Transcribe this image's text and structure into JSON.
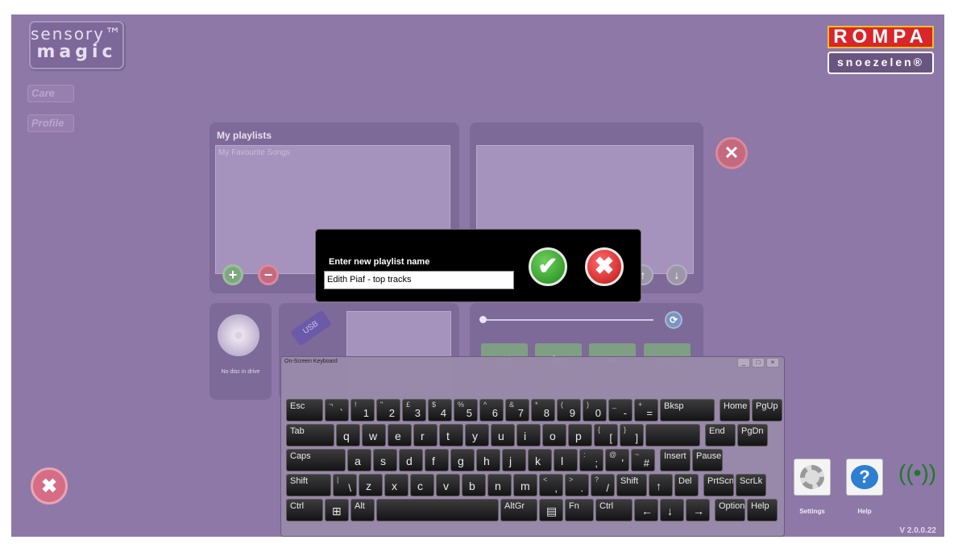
{
  "brand": {
    "line1": "sensory™",
    "line2": "magic",
    "care": "Care",
    "profile": "Profile"
  },
  "rompa": {
    "top": "ROMPA",
    "bottom": "snoezelen®"
  },
  "playlists": {
    "title": "My playlists",
    "items": [
      "My Favourite Songs"
    ]
  },
  "disc": {
    "label": "No disc in drive",
    "usb": "USB"
  },
  "dialog": {
    "label": "Enter new playlist name",
    "value": "Edith Piaf - top tracks"
  },
  "keyboard": {
    "title": "On-Screen Keyboard",
    "rows": [
      [
        [
          "Esc",
          ""
        ],
        [
          "¬",
          "`"
        ],
        [
          "!",
          "1"
        ],
        [
          "\"",
          "2"
        ],
        [
          "£",
          "3"
        ],
        [
          "$",
          "4"
        ],
        [
          "%",
          "5"
        ],
        [
          "^",
          "6"
        ],
        [
          "&",
          "7"
        ],
        [
          "*",
          "8"
        ],
        [
          "(",
          "9"
        ],
        [
          ")",
          "0"
        ],
        [
          "_",
          "-"
        ],
        [
          "+",
          "="
        ],
        [
          "Bksp",
          ""
        ],
        [
          "Home",
          ""
        ],
        [
          "PgUp",
          ""
        ]
      ],
      [
        [
          "Tab",
          ""
        ],
        [
          "",
          "q"
        ],
        [
          "",
          "w"
        ],
        [
          "",
          "e"
        ],
        [
          "",
          "r"
        ],
        [
          "",
          "t"
        ],
        [
          "",
          "y"
        ],
        [
          "",
          "u"
        ],
        [
          "",
          "i"
        ],
        [
          "",
          "o"
        ],
        [
          "",
          "p"
        ],
        [
          "{",
          "["
        ],
        [
          "}",
          "]"
        ],
        [
          "",
          ""
        ],
        [
          "End",
          ""
        ],
        [
          "PgDn",
          ""
        ]
      ],
      [
        [
          "Caps",
          ""
        ],
        [
          "",
          "a"
        ],
        [
          "",
          "s"
        ],
        [
          "",
          "d"
        ],
        [
          "",
          "f"
        ],
        [
          "",
          "g"
        ],
        [
          "",
          "h"
        ],
        [
          "",
          "j"
        ],
        [
          "",
          "k"
        ],
        [
          "",
          "l"
        ],
        [
          ":",
          ";"
        ],
        [
          "@",
          "'"
        ],
        [
          "~",
          "#"
        ],
        [
          "Insert",
          ""
        ],
        [
          "Pause",
          ""
        ]
      ],
      [
        [
          "Shift",
          ""
        ],
        [
          "|",
          "\\"
        ],
        [
          "",
          "z"
        ],
        [
          "",
          "x"
        ],
        [
          "",
          "c"
        ],
        [
          "",
          "v"
        ],
        [
          "",
          "b"
        ],
        [
          "",
          "n"
        ],
        [
          "",
          "m"
        ],
        [
          "<",
          ","
        ],
        [
          ">",
          "."
        ],
        [
          "?",
          "/"
        ],
        [
          "Shift",
          ""
        ],
        [
          "↑",
          ""
        ],
        [
          "Del",
          ""
        ],
        [
          "PrtScn",
          ""
        ],
        [
          "ScrLk",
          ""
        ]
      ],
      [
        [
          "Ctrl",
          ""
        ],
        [
          "⊞",
          ""
        ],
        [
          "Alt",
          ""
        ],
        [
          "",
          ""
        ],
        [
          "AltGr",
          ""
        ],
        [
          "▤",
          ""
        ],
        [
          "Fn",
          ""
        ],
        [
          "Ctrl",
          ""
        ],
        [
          "←",
          ""
        ],
        [
          "↓",
          ""
        ],
        [
          "→",
          ""
        ],
        [
          "Options",
          ""
        ],
        [
          "Help",
          ""
        ]
      ]
    ]
  },
  "bottom": {
    "settings": "Settings",
    "help": "Help",
    "version": "V 2.0.0.22"
  },
  "colors": {
    "background": "#8d78a8",
    "accent_red": "#d8262a",
    "ok_green": "#2fa82a"
  }
}
